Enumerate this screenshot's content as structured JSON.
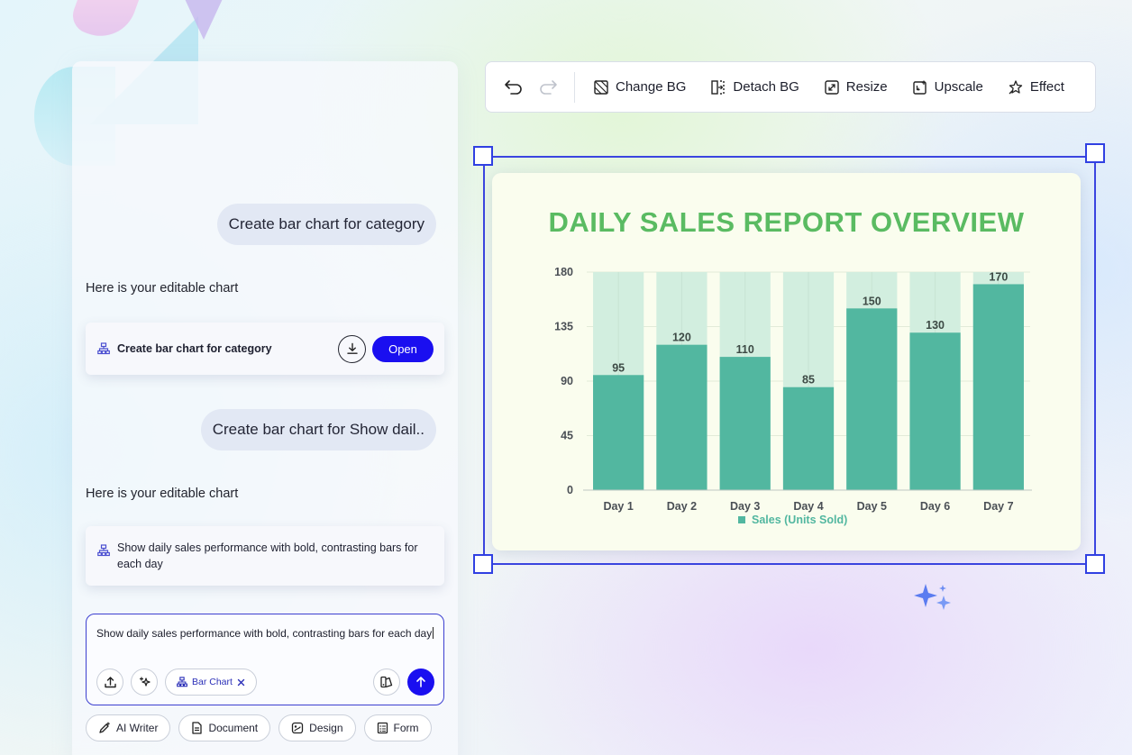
{
  "chat": {
    "messages": [
      {
        "role": "user",
        "text": "Create bar chart for category"
      },
      {
        "role": "assistant",
        "text": "Here is your editable chart"
      },
      {
        "role": "user",
        "text": "Create bar chart for Show dail.."
      },
      {
        "role": "assistant",
        "text": "Here is your editable chart"
      }
    ],
    "card1": {
      "title": "Create bar chart for category",
      "open_label": "Open"
    },
    "card2": {
      "title": "Show daily sales performance with bold, contrasting bars for each day"
    },
    "composer": {
      "value": "Show daily sales performance with bold, contrasting bars for each day",
      "chip_label": "Bar Chart"
    },
    "tools": [
      "AI Writer",
      "Document",
      "Design",
      "Form"
    ]
  },
  "toolbar": {
    "change_bg": "Change BG",
    "detach_bg": "Detach BG",
    "resize": "Resize",
    "upscale": "Upscale",
    "effect": "Effect"
  },
  "colors": {
    "accent": "#1a0ff0",
    "selection": "#3b45e0",
    "bar": "#52b7a0",
    "bar_bg": "#d2eedf",
    "title": "#5abb62"
  },
  "chart_data": {
    "type": "bar",
    "title": "DAILY SALES REPORT OVERVIEW",
    "categories": [
      "Day 1",
      "Day 2",
      "Day 3",
      "Day 4",
      "Day 5",
      "Day 6",
      "Day 7"
    ],
    "series": [
      {
        "name": "Sales (Units Sold)",
        "values": [
          95,
          120,
          110,
          85,
          150,
          130,
          170
        ]
      }
    ],
    "ylim": [
      0,
      180
    ],
    "yticks": [
      0,
      45,
      90,
      135,
      180
    ],
    "grid": true,
    "legend": "bottom"
  }
}
